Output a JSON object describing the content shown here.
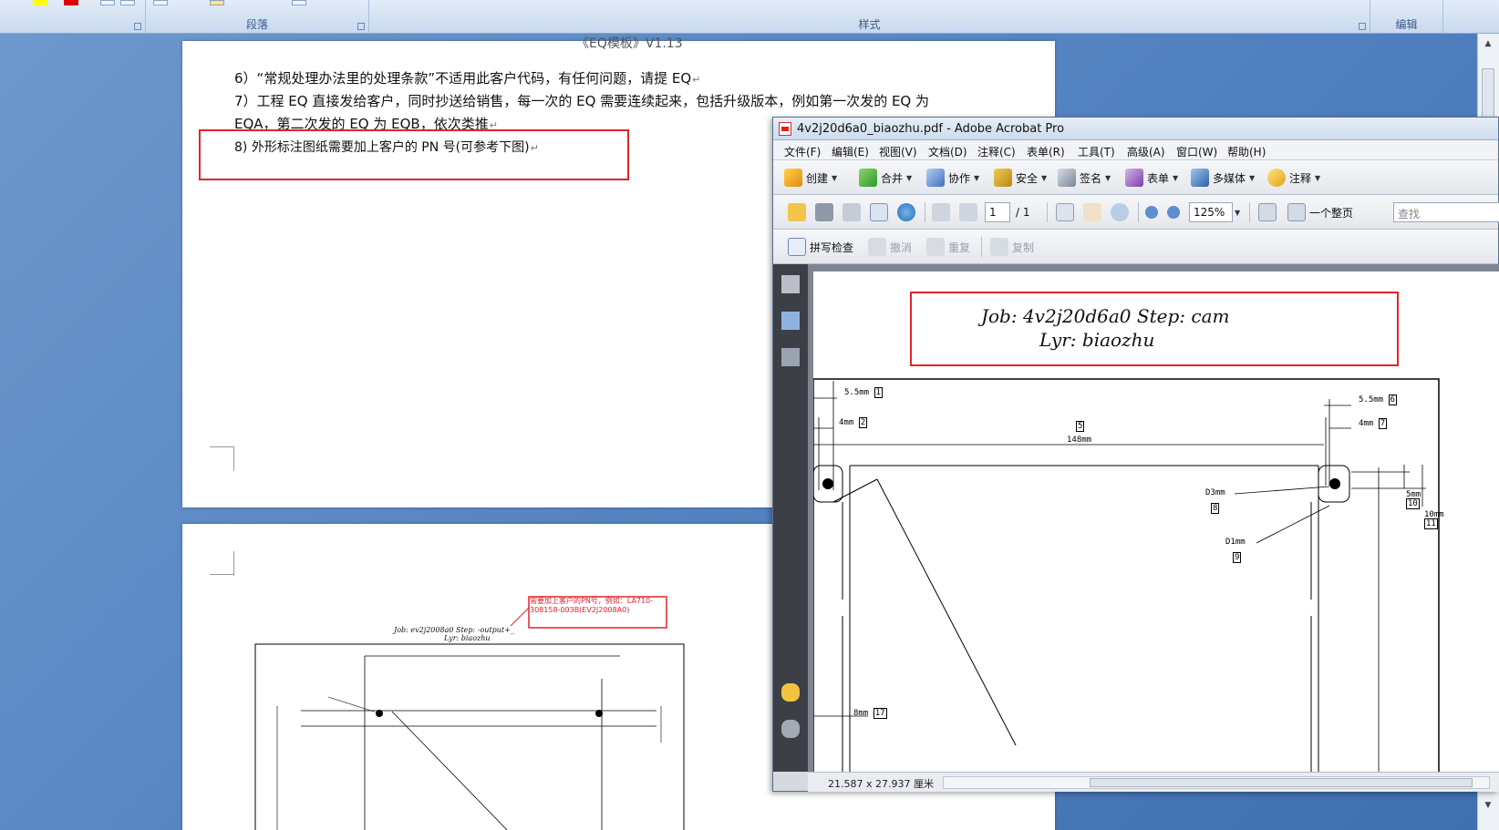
{
  "ribbon": {
    "groups": {
      "paragraph": "段落",
      "styles": "样式",
      "editing": "编辑"
    }
  },
  "word": {
    "lines": [
      "6）“常规处理办法里的处理条款”不适用此客户代码，有任何问题，请提 EQ",
      "7）工程 EQ 直接发给客户，同时抄送给销售，每一次的 EQ 需要连续起来，包括升级版本，例如第一次发的 EQ 为",
      "EQA，第二次发的 EQ 为 EQB，依次类推",
      "8) 外形标注图纸需要加上客户的 PN 号(可参考下图)"
    ],
    "top_fragment": "《EQ模板》V1.13",
    "page2_note": "需要加上客户的PN号，例如：LA710-308158-003B(EV2J2008A0)",
    "page2_job": "Job: ev2j2008a0  Step: -output+_",
    "page2_lyr": "Lyr: biaozhu"
  },
  "acrobat": {
    "title": "4v2j20d6a0_biaozhu.pdf - Adobe Acrobat Pro",
    "menu": [
      "文件(F)",
      "编辑(E)",
      "视图(V)",
      "文档(D)",
      "注释(C)",
      "表单(R)",
      "工具(T)",
      "高级(A)",
      "窗口(W)",
      "帮助(H)"
    ],
    "toolbar1": {
      "create": "创建",
      "combine": "合并",
      "collaborate": "协作",
      "secure": "安全",
      "sign": "签名",
      "forms": "表单",
      "multimedia": "多媒体",
      "comment": "注释"
    },
    "toolbar2": {
      "page_current": "1",
      "page_total": "/ 1",
      "zoom": "125%",
      "fit_label": "一个整页",
      "search_placeholder": "查找"
    },
    "toolbar3": {
      "spell": "拼写检查",
      "undo": "撤消",
      "redo": "重复",
      "copy": "复制"
    },
    "status": "21.587 x 27.937 厘米",
    "pdf": {
      "job_line": "Job: 4v2j20d6a0  Step: cam",
      "lyr_line": "Lyr: biaozhu",
      "dims": {
        "d1": "5.5mm",
        "n1": "1",
        "d2": "4mm",
        "n2": "2",
        "d5": "148mm",
        "n5": "5",
        "d6": "5.5mm",
        "n6": "6",
        "d7": "4mm",
        "n7": "7",
        "d8": "D3mm",
        "n8": "8",
        "d9": "D1mm",
        "n9": "9",
        "d10": "5mm",
        "n10": "10",
        "d11": "10mm",
        "n11": "11",
        "d17": "8mm",
        "n17": "17"
      }
    }
  }
}
